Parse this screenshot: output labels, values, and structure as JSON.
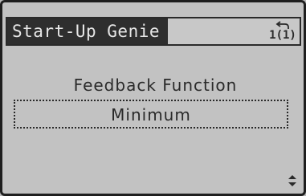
{
  "header": {
    "title": "Start-Up Genie",
    "page_indicator": "1(1)",
    "back_icon": "back-arrow-icon"
  },
  "parameter": {
    "label": "Feedback Function",
    "value": "Minimum"
  },
  "footer": {
    "scroll_icon": "up-down-arrow-icon"
  }
}
